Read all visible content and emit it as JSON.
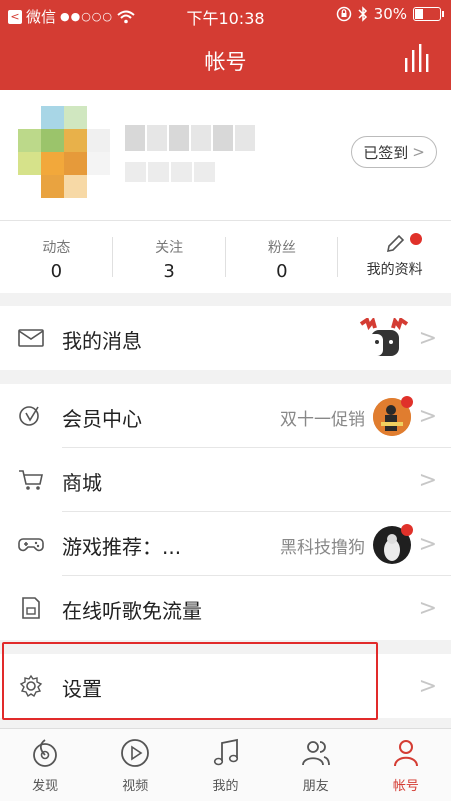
{
  "statusbar": {
    "carrier": "微信",
    "time": "下午10:38",
    "battery": "30%"
  },
  "navbar": {
    "title": "帐号"
  },
  "profile": {
    "checkin_label": "已签到"
  },
  "stats": [
    {
      "label": "动态",
      "value": "0"
    },
    {
      "label": "关注",
      "value": "3"
    },
    {
      "label": "粉丝",
      "value": "0"
    },
    {
      "label": "我的资料"
    }
  ],
  "menu": {
    "messages": {
      "label": "我的消息"
    },
    "vip": {
      "label": "会员中心",
      "sub": "双十一促销"
    },
    "mall": {
      "label": "商城"
    },
    "games": {
      "label": "游戏推荐：...",
      "sub": "黑科技撸狗"
    },
    "free_data": {
      "label": "在线听歌免流量"
    },
    "settings": {
      "label": "设置"
    }
  },
  "tabbar": [
    {
      "label": "发现"
    },
    {
      "label": "视频"
    },
    {
      "label": "我的"
    },
    {
      "label": "朋友"
    },
    {
      "label": "帐号",
      "active": true
    }
  ],
  "colors": {
    "brand": "#d43c33",
    "highlight": "#e12a2a"
  }
}
